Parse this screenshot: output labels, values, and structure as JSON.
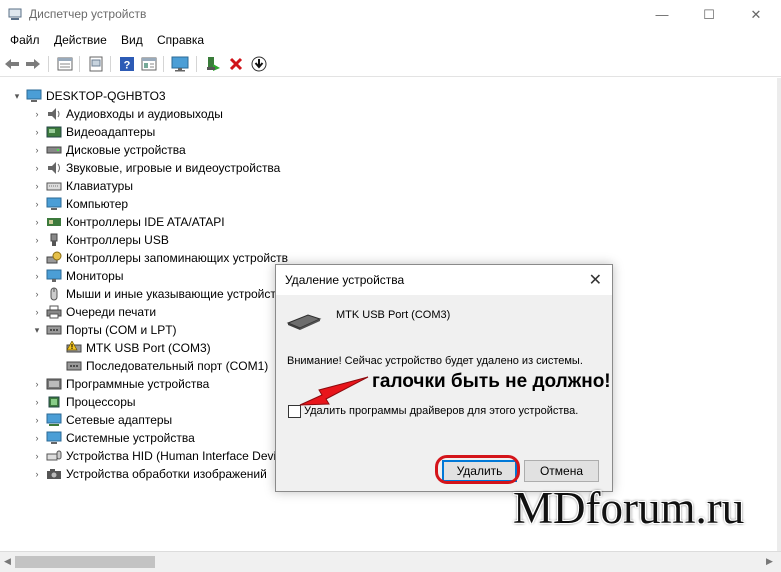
{
  "window": {
    "title": "Диспетчер устройств",
    "controls": {
      "minimize": "—",
      "maximize": "☐",
      "close": "✕"
    }
  },
  "menu": [
    "Файл",
    "Действие",
    "Вид",
    "Справка"
  ],
  "toolbar": {
    "icons": [
      "back-arrow-icon",
      "forward-arrow-icon",
      "properties-icon",
      "update-driver-icon",
      "help-icon",
      "view-icon",
      "scan-hardware-icon",
      "enable-device-icon",
      "uninstall-x-icon",
      "download-driver-icon"
    ]
  },
  "tree": {
    "root": "DESKTOP-QGHBTO3",
    "items": [
      "Аудиовходы и аудиовыходы",
      "Видеоадаптеры",
      "Дисковые устройства",
      "Звуковые, игровые и видеоустройства",
      "Клавиатуры",
      "Компьютер",
      "Контроллеры IDE ATA/ATAPI",
      "Контроллеры USB",
      "Контроллеры запоминающих устройств",
      "Мониторы",
      "Мыши и иные указывающие устройства",
      "Очереди печати",
      "Порты (COM и LPT)",
      "Программные устройства",
      "Процессоры",
      "Сетевые адаптеры",
      "Системные устройства",
      "Устройства HID (Human Interface Devices)",
      "Устройства обработки изображений"
    ],
    "ports_children": [
      "MTK USB Port (COM3)",
      "Последовательный порт (COM1)"
    ]
  },
  "dialog": {
    "title": "Удаление устройства",
    "close": "✕",
    "device_name": "MTK USB Port (COM3)",
    "warning": "Внимание! Сейчас устройство будет удалено из системы.",
    "checkbox_label": "Удалить программы драйверов для этого устройства.",
    "checkbox_checked": false,
    "ok_button": "Удалить",
    "cancel_button": "Отмена"
  },
  "annotation": {
    "text": "галочки быть не должно!",
    "color": "#d4141a"
  },
  "watermark": "MDforum.ru",
  "colors": {
    "accent": "#0078d7",
    "highlight_ring": "#d4141a",
    "arrow": "#e8151b"
  }
}
